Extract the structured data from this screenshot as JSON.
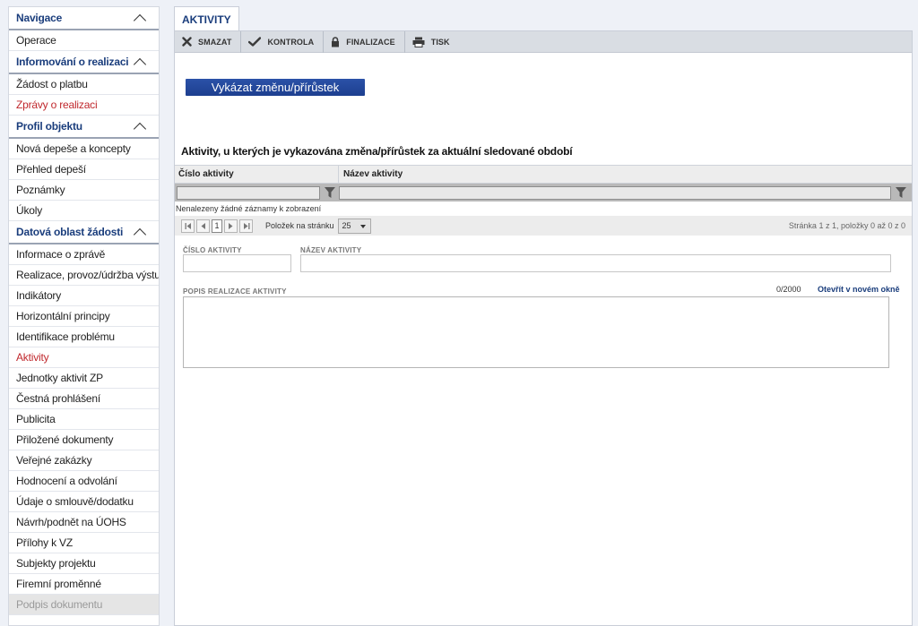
{
  "sidebar": {
    "sections": [
      {
        "title": "Navigace",
        "items": [
          {
            "label": "Operace"
          }
        ]
      },
      {
        "title": "Informování o realizaci",
        "items": [
          {
            "label": "Žádost o platbu"
          },
          {
            "label": "Zprávy o realizaci",
            "active": true
          }
        ]
      },
      {
        "title": "Profil objektu",
        "items": [
          {
            "label": "Nová depeše a koncepty"
          },
          {
            "label": "Přehled depeší"
          },
          {
            "label": "Poznámky"
          },
          {
            "label": "Úkoly"
          }
        ]
      },
      {
        "title": "Datová oblast žádosti",
        "items": [
          {
            "label": "Informace o zprávě"
          },
          {
            "label": "Realizace, provoz/údržba výstupu"
          },
          {
            "label": "Indikátory"
          },
          {
            "label": "Horizontální principy"
          },
          {
            "label": "Identifikace problému"
          },
          {
            "label": "Aktivity",
            "active": true
          },
          {
            "label": "Jednotky aktivit ZP"
          },
          {
            "label": "Čestná prohlášení"
          },
          {
            "label": "Publicita"
          },
          {
            "label": "Přiložené dokumenty"
          },
          {
            "label": "Veřejné zakázky"
          },
          {
            "label": "Hodnocení a odvolání"
          },
          {
            "label": "Údaje o smlouvě/dodatku"
          },
          {
            "label": "Návrh/podnět na ÚOHS"
          },
          {
            "label": "Přílohy k VZ"
          },
          {
            "label": "Subjekty projektu"
          },
          {
            "label": "Firemní proměnné"
          },
          {
            "label": "Podpis dokumentu",
            "disabled": true
          }
        ]
      }
    ]
  },
  "main": {
    "tab_label": "AKTIVITY",
    "toolbar": {
      "delete_label": "SMAZAT",
      "check_label": "KONTROLA",
      "finalize_label": "FINALIZACE",
      "print_label": "TISK"
    },
    "primary_button_label": "Vykázat změnu/přírůstek",
    "section_title": "Aktivity, u kterých je vykazována změna/přírůstek za aktuální sledované období",
    "grid": {
      "columns": [
        "Číslo aktivity",
        "Název aktivity"
      ],
      "empty_message": "Nenalezeny žádné záznamy k zobrazení",
      "pager": {
        "current_page": "1",
        "per_page_label": "Položek na stránku",
        "per_page_value": "25",
        "status": "Stránka 1 z 1, položky 0 až 0 z 0"
      }
    },
    "form": {
      "activity_number_label": "ČÍSLO AKTIVITY",
      "activity_name_label": "NÁZEV AKTIVITY",
      "description_label": "POPIS REALIZACE AKTIVITY",
      "counter": "0/2000",
      "open_new_window_label": "Otevřít v novém okně"
    }
  },
  "colors": {
    "accent": "#1a3d7c",
    "active_nav": "#c0282d",
    "primary_button": "#2549a0"
  }
}
